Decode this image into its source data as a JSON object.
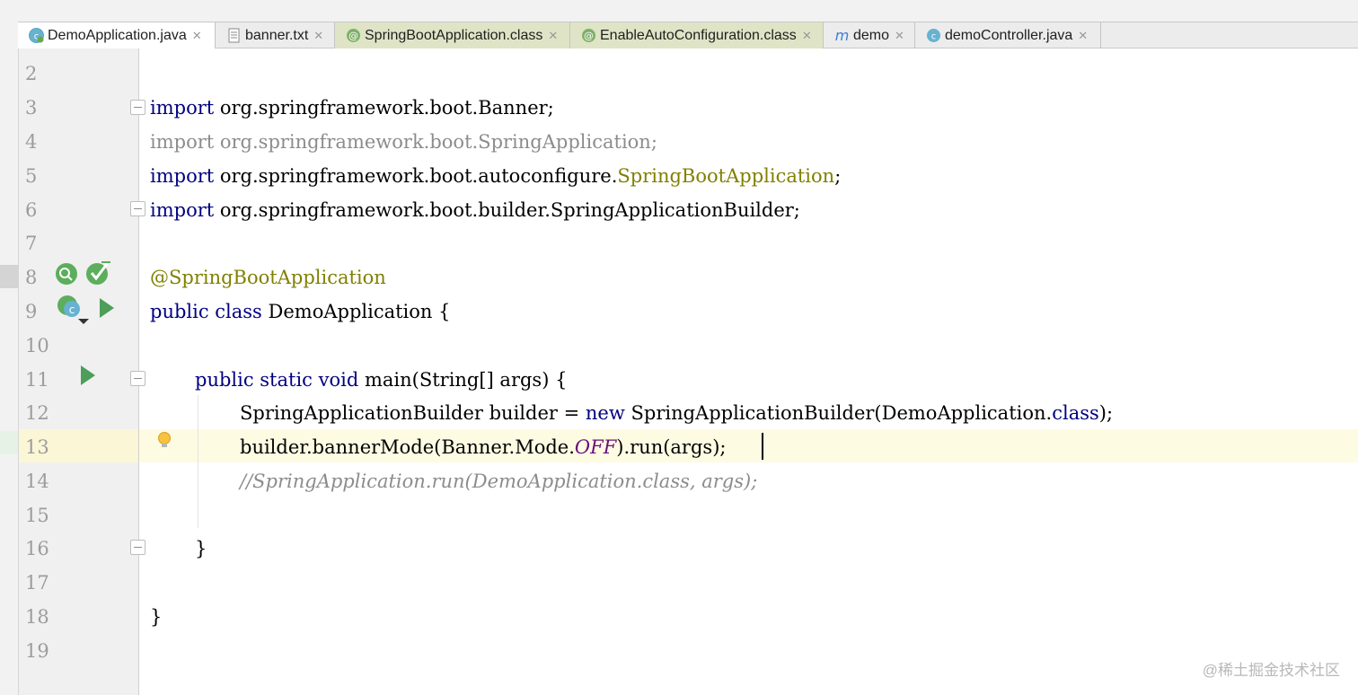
{
  "colors": {
    "keyword": "#000080",
    "annotation": "#808000",
    "comment": "#8c8c8c",
    "static_field": "#660e7a",
    "current_line": "#fefbe3",
    "run_icon": "#4c9e5a"
  },
  "tabs": [
    {
      "label": "DemoApplication.java",
      "icon": "spring-class-icon",
      "active": true
    },
    {
      "label": "banner.txt",
      "icon": "text-file-icon",
      "active": false
    },
    {
      "label": "SpringBootApplication.class",
      "icon": "annotation-icon",
      "active": false
    },
    {
      "label": "EnableAutoConfiguration.class",
      "icon": "annotation-icon",
      "active": false
    },
    {
      "label": "demo",
      "icon": "maven-icon",
      "active": false
    },
    {
      "label": "demoController.java",
      "icon": "class-icon",
      "active": false
    }
  ],
  "editor": {
    "line_numbers": [
      "2",
      "3",
      "4",
      "5",
      "6",
      "7",
      "8",
      "9",
      "10",
      "11",
      "12",
      "13",
      "14",
      "15",
      "16",
      "17",
      "18",
      "19"
    ],
    "code": {
      "l3_kw": "import",
      "l3_rest": " org.springframework.boot.Banner;",
      "l4_text": "import org.springframework.boot.SpringApplication;",
      "l5_kw": "import",
      "l5_pkg": " org.springframework.boot.autoconfigure.",
      "l5_cls": "SpringBootApplication",
      "l5_end": ";",
      "l6_kw": "import",
      "l6_rest": " org.springframework.boot.builder.SpringApplicationBuilder;",
      "l8_anno": "@SpringBootApplication",
      "l9_kw": "public class",
      "l9_rest": " DemoApplication {",
      "l11_kw": "public static void",
      "l11_rest": " main(String[] args) {",
      "l12_a": "SpringApplicationBuilder builder = ",
      "l12_kw": "new",
      "l12_b": " SpringApplicationBuilder(DemoApplication.",
      "l12_kw2": "class",
      "l12_c": ");",
      "l13_a": "builder.bannerMode(Banner.Mode.",
      "l13_field": "OFF",
      "l13_b": ").run(args);",
      "l14_comment": "//SpringApplication.run(DemoApplication.class, args);",
      "l16": "}",
      "l18": "}"
    }
  },
  "watermark": "@稀土掘金技术社区"
}
